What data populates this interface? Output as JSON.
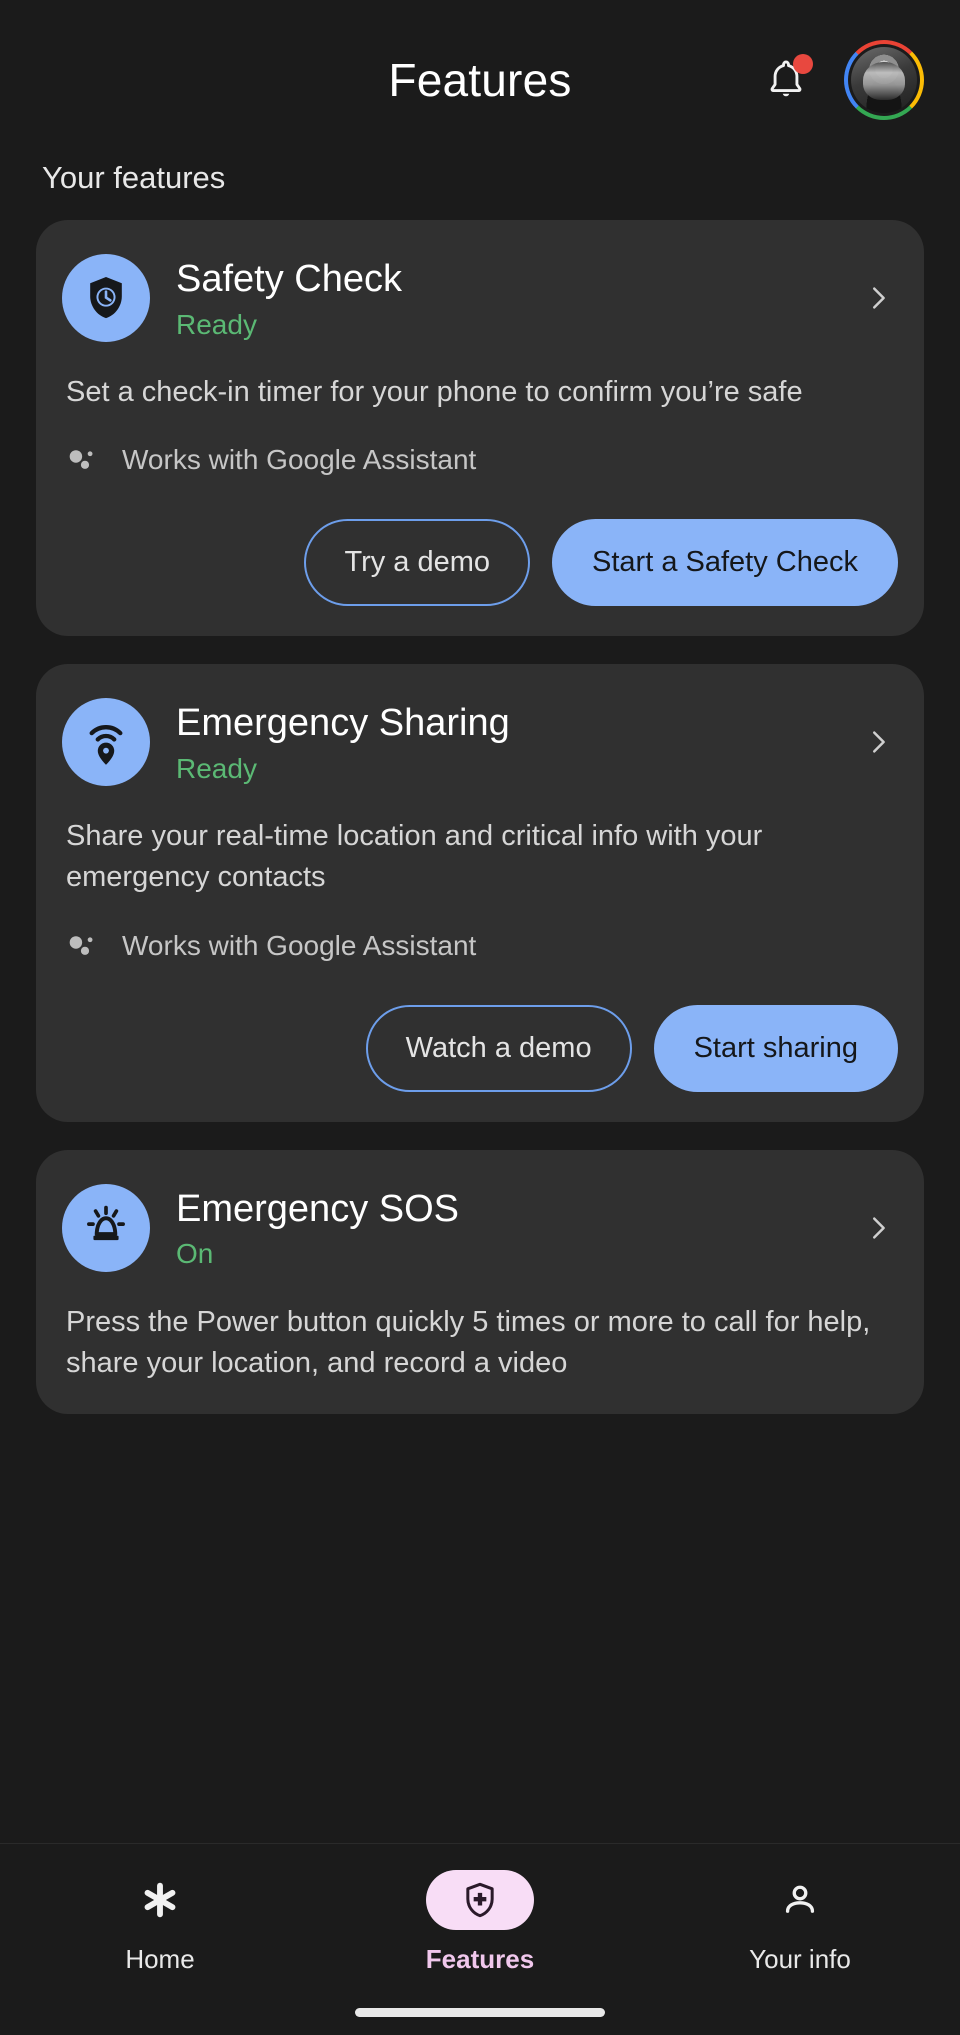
{
  "appbar": {
    "title": "Features",
    "notification_icon": "bell-icon",
    "has_notification_dot": true,
    "avatar_icon": "account-avatar"
  },
  "section": {
    "label": "Your features"
  },
  "cards": [
    {
      "icon": "shield-clock-icon",
      "title": "Safety Check",
      "status": "Ready",
      "status_color": "#5bb974",
      "description": "Set a check-in timer for your phone to confirm you’re safe",
      "assistant_note": "Works with Google Assistant",
      "actions": [
        {
          "label": "Try a demo",
          "style": "outline"
        },
        {
          "label": "Start a Safety Check",
          "style": "filled"
        }
      ]
    },
    {
      "icon": "location-broadcast-icon",
      "title": "Emergency Sharing",
      "status": "Ready",
      "status_color": "#5bb974",
      "description": "Share your real-time location and critical info with your emergency contacts",
      "assistant_note": "Works with Google Assistant",
      "actions": [
        {
          "label": "Watch a demo",
          "style": "outline"
        },
        {
          "label": "Start sharing",
          "style": "filled"
        }
      ]
    },
    {
      "icon": "siren-beacon-icon",
      "title": "Emergency SOS",
      "status": "On",
      "status_color": "#5bb974",
      "description": "Press the Power button quickly 5 times or more to call for help, share your location, and record a video",
      "assistant_note": "",
      "actions": []
    }
  ],
  "bottom_nav": {
    "items": [
      {
        "label": "Home",
        "icon": "asterisk-icon",
        "active": false
      },
      {
        "label": "Features",
        "icon": "shield-cross-icon",
        "active": true
      },
      {
        "label": "Your info",
        "icon": "person-icon",
        "active": false
      }
    ]
  },
  "colors": {
    "background": "#1b1b1b",
    "card": "#303030",
    "accent_blue": "#8ab4f8",
    "accent_pink": "#f8ddf6",
    "status_green": "#5bb974",
    "notification_red": "#e8483f"
  }
}
